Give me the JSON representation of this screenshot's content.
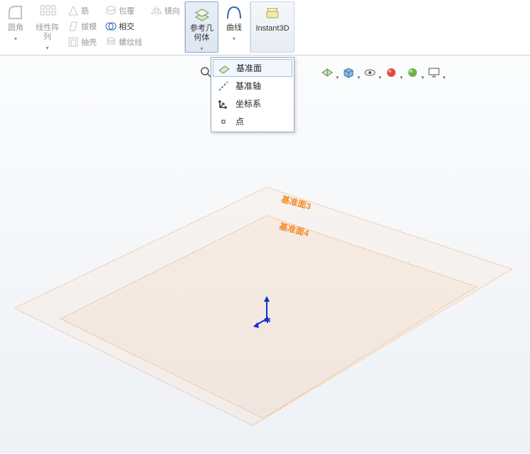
{
  "ribbon": {
    "fillet": "圆角",
    "linpat": "线性阵\n列",
    "rib": "筋",
    "draft": "拔模",
    "shell": "抽壳",
    "wrap": "包覆",
    "intersect": "相交",
    "thread": "螺纹线",
    "mirror": "镜向",
    "refgeom": "参考几\n何体",
    "curves": "曲线",
    "instant3d": "Instant3D"
  },
  "menu": {
    "plane": "基准面",
    "axis": "基准轴",
    "csys": "坐标系",
    "point": "点"
  },
  "planes": {
    "p3": "基准面3",
    "p4": "基准面4"
  }
}
